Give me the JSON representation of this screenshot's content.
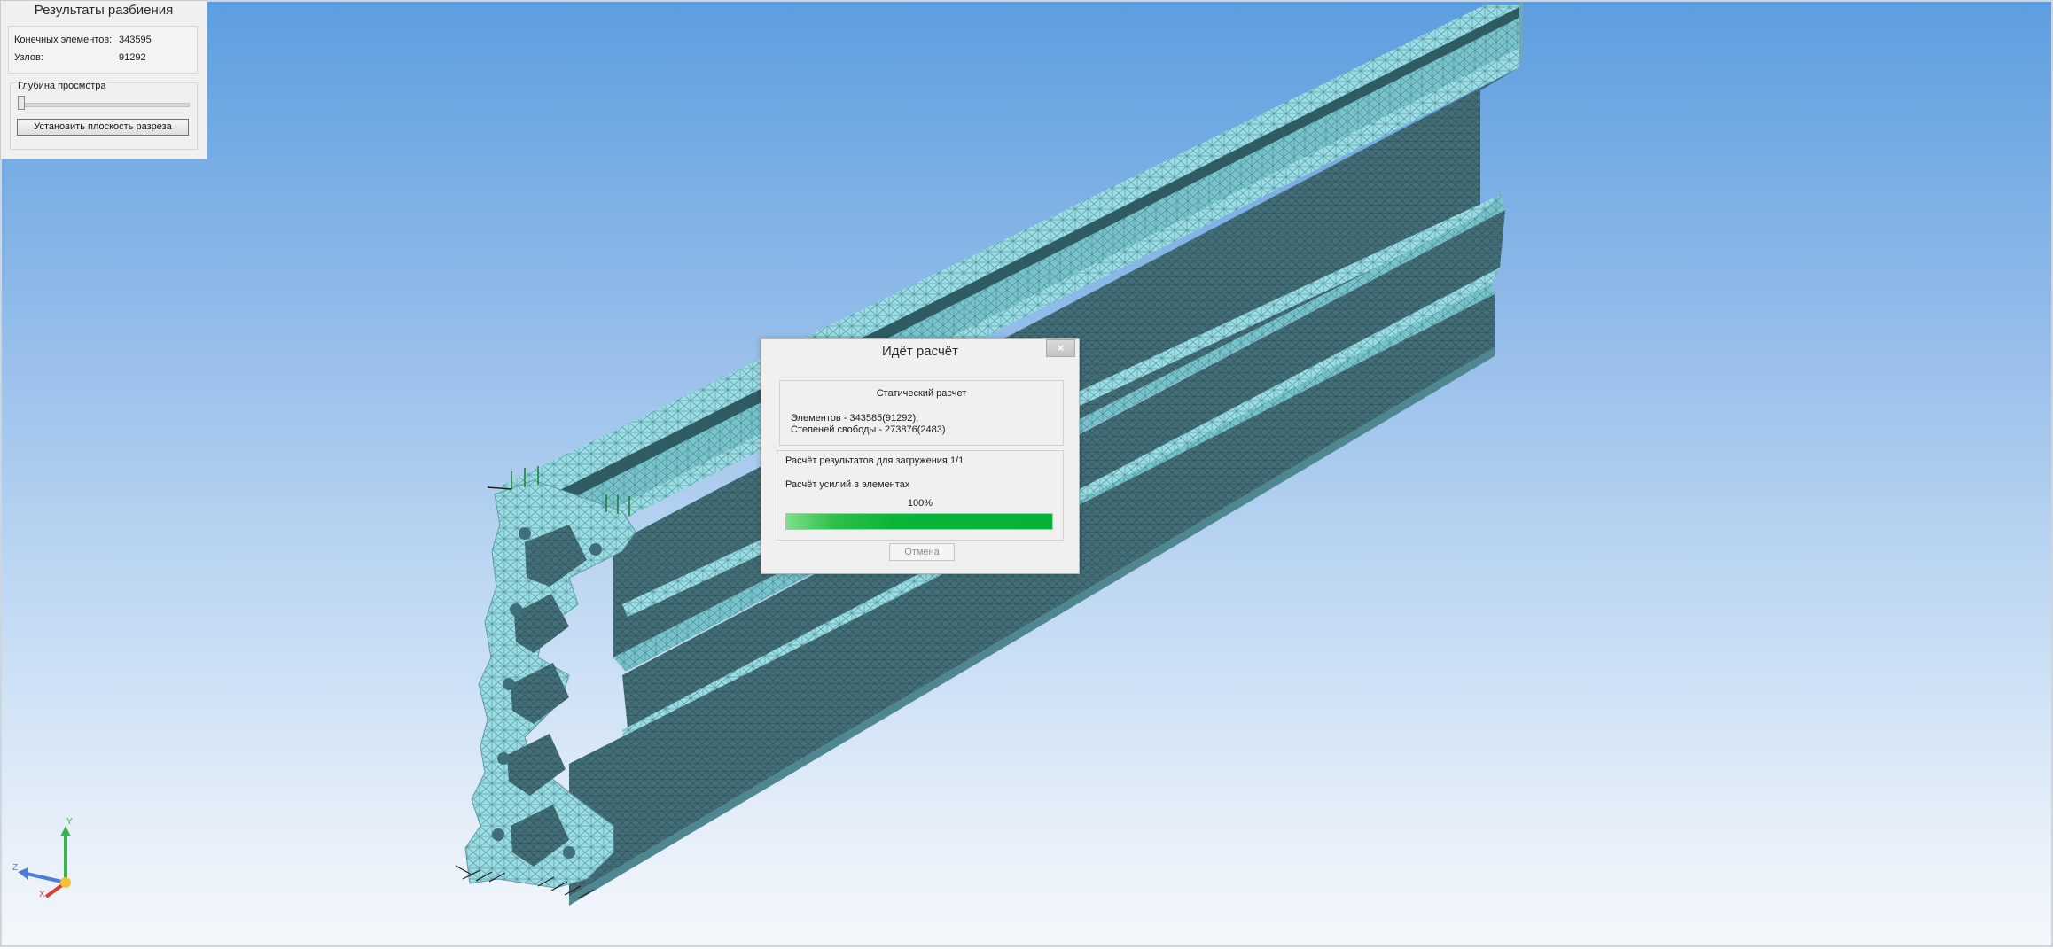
{
  "mesh_panel": {
    "title": "Результаты разбиения",
    "elements_label": "Конечных элементов:",
    "elements_value": "343595",
    "nodes_label": "Узлов:",
    "nodes_value": "91292",
    "depth_label": "Глубина просмотра",
    "depth_value": 0,
    "set_plane_button": "Установить плоскость разреза"
  },
  "dialog": {
    "title": "Идёт расчёт",
    "close_glyph": "×",
    "calc_type": "Статический расчет",
    "elements_line": "Элементов - 343585(91292),",
    "dof_line": "Степеней свободы - 273876(2483)",
    "stage_line": "Расчёт результатов для загружения 1/1",
    "task_line": "Расчёт усилий в элементах",
    "progress_text": "100%",
    "progress": 1.0,
    "cancel_button": "Отмена"
  },
  "triad": {
    "y_label": "Y",
    "z_label": "Z",
    "x_label": "X"
  },
  "colors": {
    "mesh_light": "#94dbe2",
    "mesh_dark": "#3f6f78",
    "progress_green": "#06b238",
    "load_arrow": "#1c7a2a"
  }
}
